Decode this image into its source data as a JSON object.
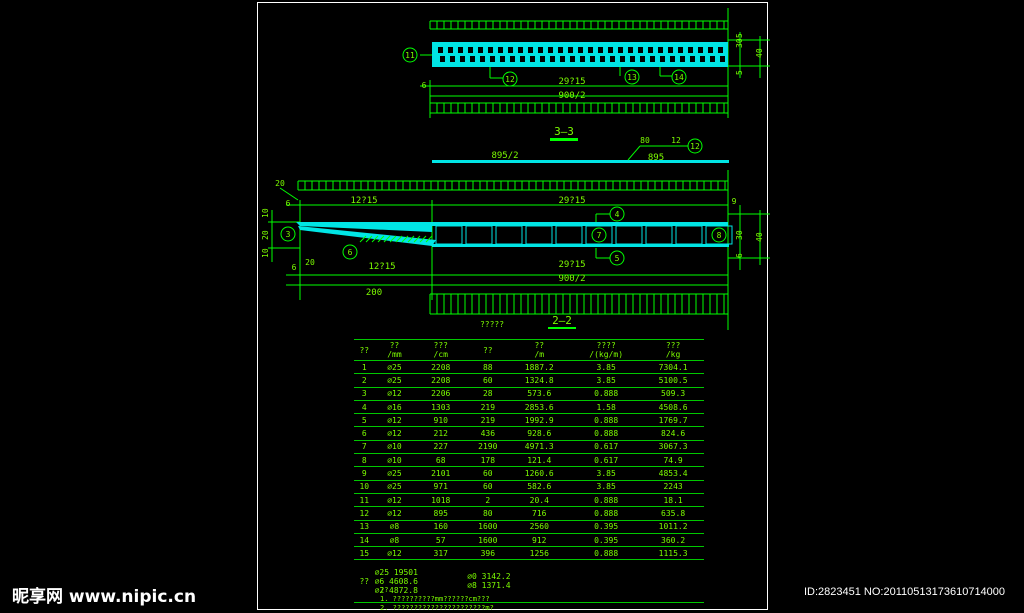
{
  "section_33": {
    "title": "3—3",
    "callout_11": "11",
    "callout_12": "12",
    "callout_13": "13",
    "callout_14": "14",
    "dim_spacing": "29?15",
    "dim_half": "900/2",
    "dim_left": "6",
    "dim_r1": "30",
    "dim_r2": "5",
    "dim_r3": "40",
    "dim_r4": "5"
  },
  "bar12": {
    "left": "895/2",
    "right": "895",
    "top_a": "80",
    "top_b": "12",
    "callout": "12"
  },
  "section_22": {
    "title": "2—2",
    "dim_20": "20",
    "dim_6": "6",
    "dim_1215": "12?15",
    "dim_2915": "29?15",
    "dim_left_v1": "10",
    "dim_left_v2": "20",
    "dim_left_v3": "10",
    "dim_right1": "9",
    "dim_right2": "30",
    "dim_right3": "6",
    "dim_right4": "40",
    "dim_b20": "20",
    "dim_b6": "6",
    "dim_b1215": "12?15",
    "dim_b2915": "29?15",
    "dim_b900": "900/2",
    "dim_200": "200",
    "c3": "3",
    "c4": "4",
    "c5": "5",
    "c6": "6",
    "c7": "7",
    "c8": "8"
  },
  "table_caption": "?????",
  "schedule": {
    "headers": [
      "??",
      "??\n/mm",
      "???\n/cm",
      "??",
      "??\n/m",
      "????\n/(kg/m)",
      "???\n/kg"
    ],
    "rows": [
      [
        "1",
        "⌀25",
        "2208",
        "88",
        "1887.2",
        "3.85",
        "7304.1"
      ],
      [
        "2",
        "⌀25",
        "2208",
        "60",
        "1324.8",
        "3.85",
        "5100.5"
      ],
      [
        "3",
        "⌀12",
        "2206",
        "28",
        "573.6",
        "0.888",
        "509.3"
      ],
      [
        "4",
        "⌀16",
        "1303",
        "219",
        "2853.6",
        "1.58",
        "4508.6"
      ],
      [
        "5",
        "⌀12",
        "910",
        "219",
        "1992.9",
        "0.888",
        "1769.7"
      ],
      [
        "6",
        "⌀12",
        "212",
        "436",
        "928.6",
        "0.888",
        "824.6"
      ],
      [
        "7",
        "⌀10",
        "227",
        "2190",
        "4971.3",
        "0.617",
        "3067.3"
      ],
      [
        "8",
        "⌀10",
        "68",
        "178",
        "121.4",
        "0.617",
        "74.9"
      ],
      [
        "9",
        "⌀25",
        "2101",
        "60",
        "1260.6",
        "3.85",
        "4853.4"
      ],
      [
        "10",
        "⌀25",
        "971",
        "60",
        "582.6",
        "3.85",
        "2243"
      ],
      [
        "11",
        "⌀12",
        "1018",
        "2",
        "20.4",
        "0.888",
        "18.1"
      ],
      [
        "12",
        "⌀12",
        "895",
        "80",
        "716",
        "0.888",
        "635.8"
      ],
      [
        "13",
        "⌀8",
        "160",
        "1600",
        "2560",
        "0.395",
        "1011.2"
      ],
      [
        "14",
        "⌀8",
        "57",
        "1600",
        "912",
        "0.395",
        "360.2"
      ],
      [
        "15",
        "⌀12",
        "317",
        "396",
        "1256",
        "0.888",
        "1115.3"
      ]
    ],
    "summary_label": "??",
    "summary_left": [
      "⌀25 19501",
      "⌀6 4608.6",
      "⌀2 4872.8"
    ],
    "summary_right": [
      "⌀0 3142.2",
      "⌀8 1371.4"
    ]
  },
  "notes": {
    "label": "??",
    "line1": "1. ??????????mm??????cm???",
    "line2": "2. ??????????????????????m?"
  },
  "watermark": {
    "left": "昵享网 www.nipic.cn",
    "right": "ID:2823451 NO:20110513173610714000"
  }
}
